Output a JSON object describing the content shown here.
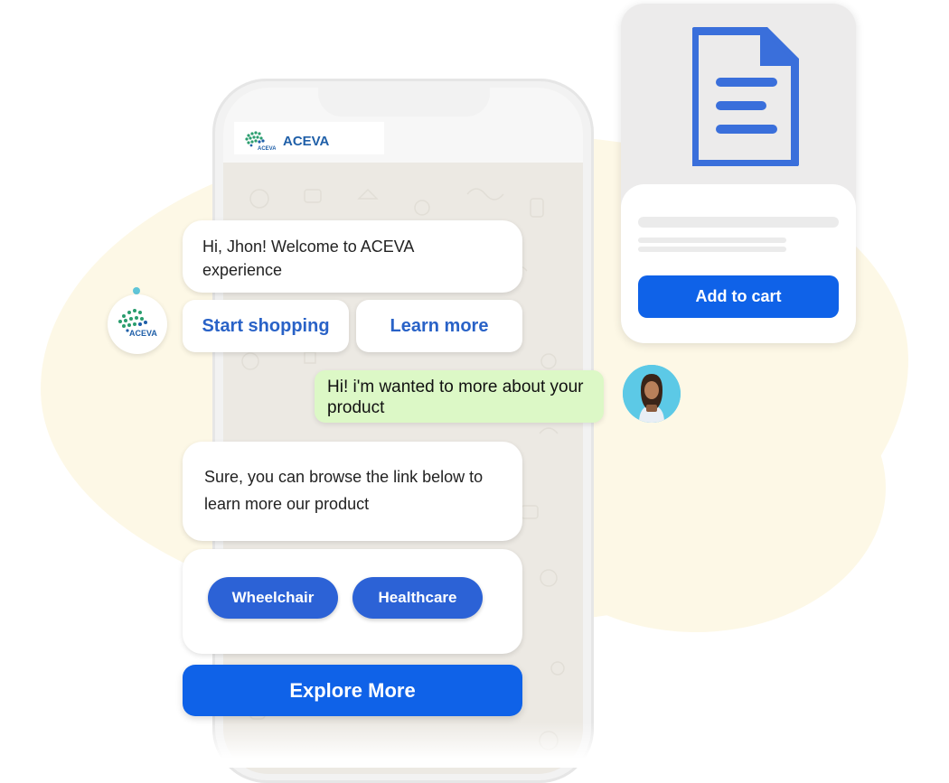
{
  "app": {
    "brand_name": "ACEVA",
    "logo_text": "ACEVA"
  },
  "chat": {
    "greeting": "Hi, Jhon!  Welcome to  ACEVA experience",
    "options": [
      "Start shopping",
      "Learn more"
    ],
    "user_message": "Hi! i'm wanted to more about your product",
    "bot_reply": "Sure, you can browse the link below to learn more our product",
    "chips": [
      "Wheelchair",
      "Healthcare"
    ],
    "explore_label": "Explore More"
  },
  "product_card": {
    "icon": "document-icon",
    "cart_label": "Add to cart"
  },
  "colors": {
    "primary": "#0f62e8",
    "chip": "#2c62d6",
    "user_bubble": "#dcf8c6",
    "background_blob": "#fdf8e6",
    "doc_icon": "#3a6fdb"
  }
}
